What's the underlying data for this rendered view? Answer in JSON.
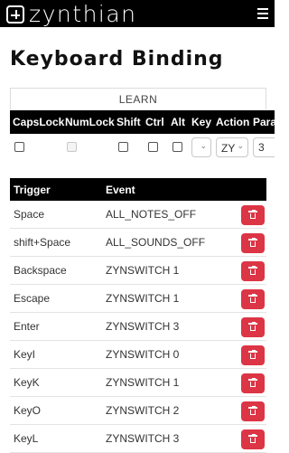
{
  "app": {
    "logo_text": "zynthian"
  },
  "page": {
    "title": "Keyboard Binding"
  },
  "learn": {
    "label": "LEARN"
  },
  "binding_form": {
    "columns": [
      "CapsLock",
      "NumLock",
      "Shift",
      "Ctrl",
      "Alt",
      "Key",
      "Action",
      "Para"
    ],
    "action_value": "ZY",
    "param_value": "3"
  },
  "events": {
    "headers": {
      "trigger": "Trigger",
      "event": "Event"
    },
    "rows": [
      {
        "trigger": "Space",
        "event": "ALL_NOTES_OFF"
      },
      {
        "trigger": "shift+Space",
        "event": "ALL_SOUNDS_OFF"
      },
      {
        "trigger": "Backspace",
        "event": "ZYNSWITCH 1"
      },
      {
        "trigger": "Escape",
        "event": "ZYNSWITCH 1"
      },
      {
        "trigger": "Enter",
        "event": "ZYNSWITCH 3"
      },
      {
        "trigger": "KeyI",
        "event": "ZYNSWITCH 0"
      },
      {
        "trigger": "KeyK",
        "event": "ZYNSWITCH 1"
      },
      {
        "trigger": "KeyO",
        "event": "ZYNSWITCH 2"
      },
      {
        "trigger": "KeyL",
        "event": "ZYNSWITCH 3"
      }
    ]
  },
  "colors": {
    "navbar": "#000000",
    "delete_button": "#dc3545"
  },
  "icons": {
    "menu": "hamburger-icon",
    "delete": "trash-icon",
    "dropdown": "chevron-down-icon"
  }
}
